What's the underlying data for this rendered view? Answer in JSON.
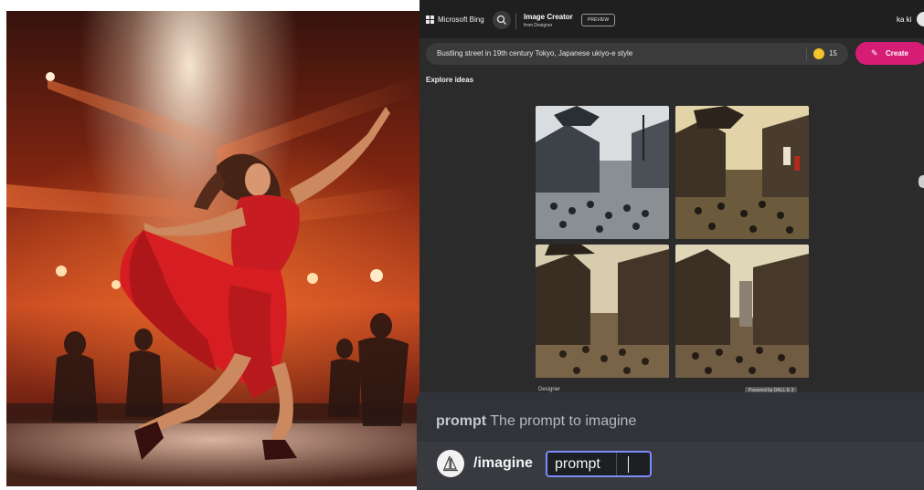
{
  "bing": {
    "brand": "Microsoft Bing",
    "app_name": "Image Creator",
    "app_sub": "from Designer",
    "preview_badge": "PREVIEW",
    "user_name": "ka ki",
    "prompt_value": "Bustling street in 19th century Tokyo, Japanese ukiyo-e style",
    "boost_count": "15",
    "create_label": "Create",
    "explore_label": "Explore ideas",
    "footer_left": "Designer",
    "footer_right": "Powered by DALL·E 3",
    "icons": {
      "search": "search-icon",
      "boost": "bolt-icon",
      "create": "brush-icon"
    }
  },
  "discord": {
    "hint_key": "prompt",
    "hint_text": "The prompt to imagine",
    "command": "/imagine",
    "field_label": "prompt"
  },
  "colors": {
    "bing_bg": "#2b2b2b",
    "create_accent": "#d61d75",
    "discord_bg": "#313338",
    "field_border": "#7c8cf8"
  }
}
